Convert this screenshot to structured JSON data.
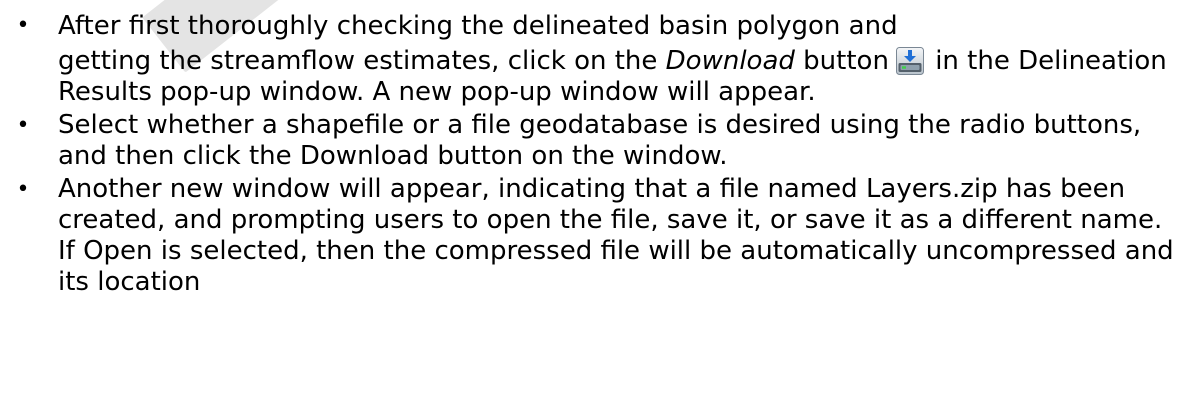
{
  "document": {
    "bullets": [
      {
        "line1": "After first thoroughly checking the delineated basin polygon and",
        "before_italic": "getting the streamflow estimates, click on the ",
        "italic": "Download",
        "after_italic": " button",
        "icon": "download-icon",
        "rest": "in the Delineation Results pop-up window. A new pop-up window will appear."
      },
      {
        "text": "Select whether a shapefile or a file geodatabase is desired using the radio buttons, and then click the Download button on the window."
      },
      {
        "text": "Another new window will appear, indicating that a file named Layers.zip has been created, and prompting users to open the file, save it, or save it as a different name.  If Open is selected, then the compressed file will be automatically uncompressed and its location"
      }
    ],
    "bullet_glyph": "•"
  }
}
